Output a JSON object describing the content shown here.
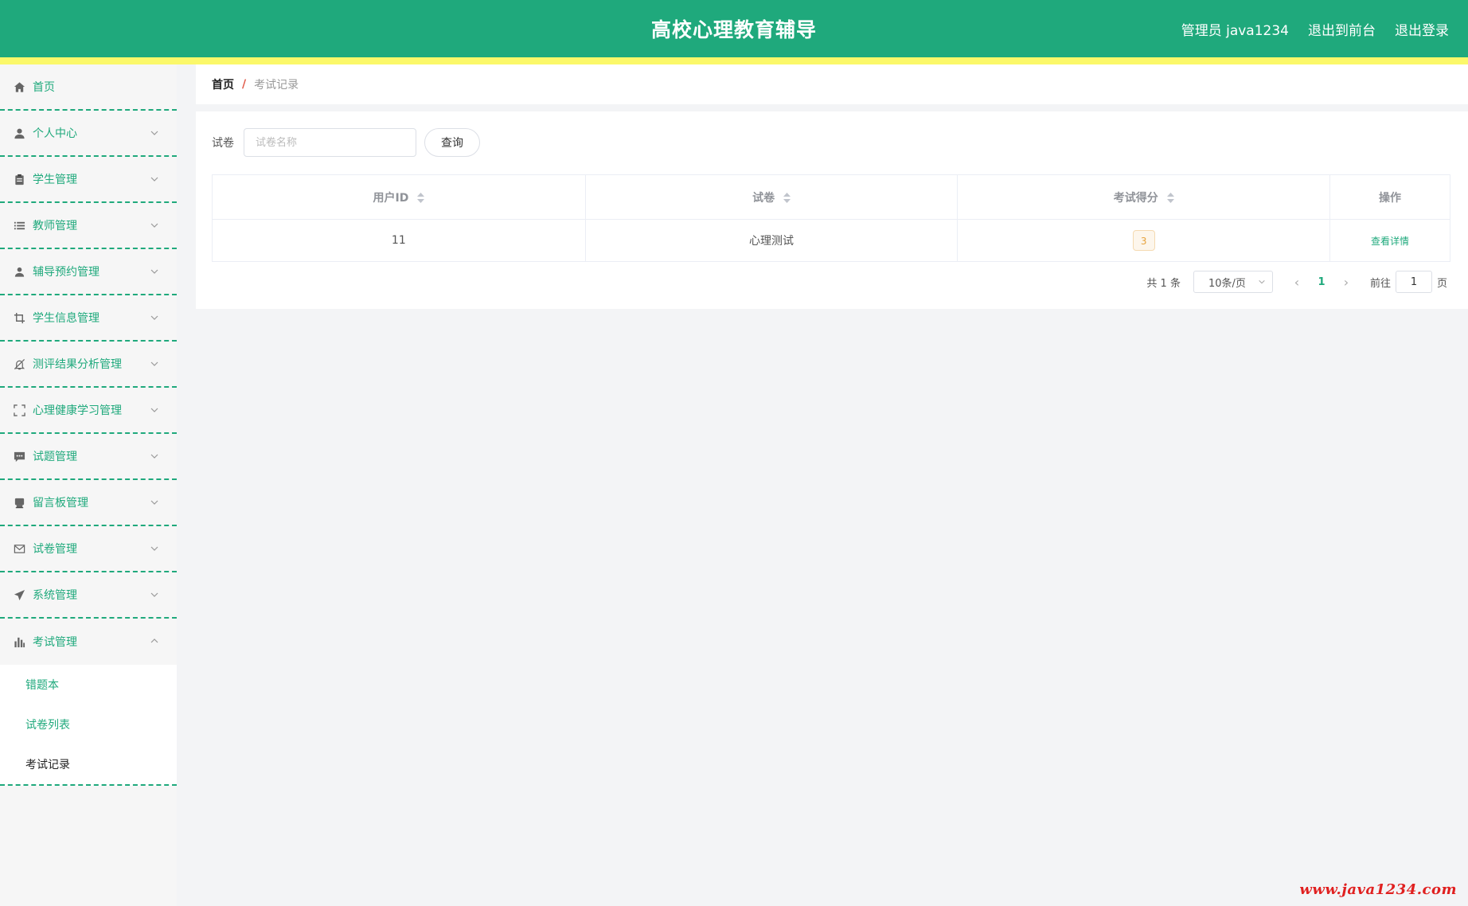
{
  "header": {
    "title": "高校心理教育辅导",
    "user": "管理员 java1234",
    "link_front": "退出到前台",
    "link_logout": "退出登录"
  },
  "colors": {
    "accent": "#1fa97c",
    "stripe": "#fbf86a",
    "separator": "#e15b4a",
    "badge": "#e6a23c"
  },
  "sidebar": {
    "items": [
      {
        "label": "首页",
        "icon": "home-icon"
      },
      {
        "label": "个人中心",
        "icon": "user-icon"
      },
      {
        "label": "学生管理",
        "icon": "clipboard-icon"
      },
      {
        "label": "教师管理",
        "icon": "list-icon"
      },
      {
        "label": "辅导预约管理",
        "icon": "person-icon"
      },
      {
        "label": "学生信息管理",
        "icon": "crop-icon"
      },
      {
        "label": "测评结果分析管理",
        "icon": "bell-off-icon"
      },
      {
        "label": "心理健康学习管理",
        "icon": "fullscreen-icon"
      },
      {
        "label": "试题管理",
        "icon": "chat-icon"
      },
      {
        "label": "留言板管理",
        "icon": "printer-icon"
      },
      {
        "label": "试卷管理",
        "icon": "mail-icon"
      },
      {
        "label": "系统管理",
        "icon": "send-icon"
      },
      {
        "label": "考试管理",
        "icon": "chart-icon"
      }
    ],
    "submenu": [
      {
        "label": "错题本"
      },
      {
        "label": "试卷列表"
      },
      {
        "label": "考试记录"
      }
    ]
  },
  "breadcrumb": {
    "home": "首页",
    "separator": "/",
    "current": "考试记录"
  },
  "search": {
    "label": "试卷",
    "placeholder": "试卷名称",
    "value": "",
    "button": "查询"
  },
  "table": {
    "columns": [
      "用户ID",
      "试卷",
      "考试得分",
      "操作"
    ],
    "rows": [
      {
        "user_id": "11",
        "paper": "心理测试",
        "score": "3",
        "action": "查看详情"
      }
    ]
  },
  "pagination": {
    "total": "共 1 条",
    "page_size": "10条/页",
    "current_page": "1",
    "goto_label": "前往",
    "goto_value": "1",
    "goto_unit": "页"
  },
  "watermark": "www.java1234.com"
}
